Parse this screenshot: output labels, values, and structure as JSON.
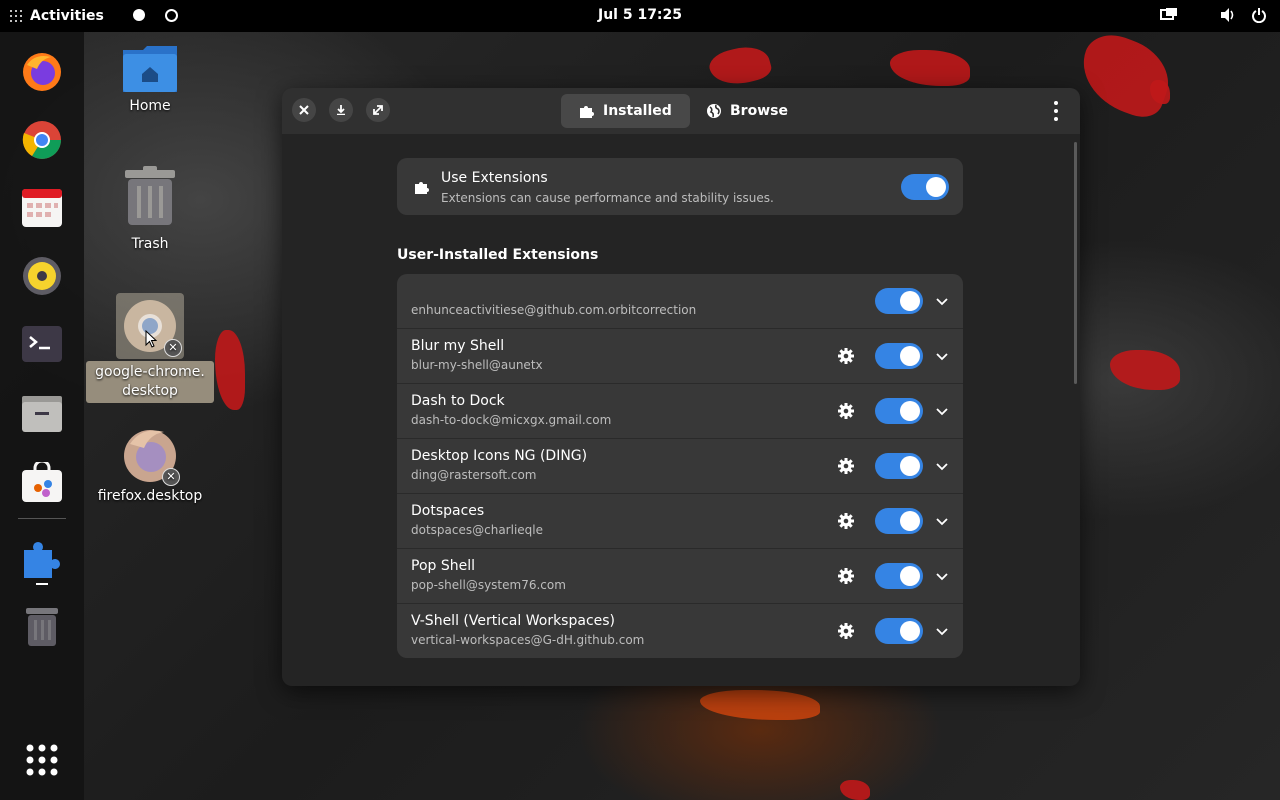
{
  "topbar": {
    "activities_label": "Activities",
    "clock": "Jul 5  17:25"
  },
  "desktop": {
    "icons": [
      {
        "label": "Home"
      },
      {
        "label": "Trash"
      },
      {
        "label": "google-chrome.\ndesktop"
      },
      {
        "label": "firefox.desktop"
      }
    ]
  },
  "dock": {
    "items": [
      "firefox-icon",
      "chrome-icon",
      "calendar-icon",
      "rhythmbox-icon",
      "terminal-icon",
      "files-icon",
      "software-icon",
      "extensions-icon",
      "trash-icon",
      "app-grid-icon"
    ]
  },
  "window": {
    "tabs": [
      {
        "label": "Installed",
        "active": true
      },
      {
        "label": "Browse",
        "active": false
      }
    ],
    "use_extensions": {
      "title": "Use Extensions",
      "subtitle": "Extensions can cause performance and stability issues.",
      "enabled": true
    },
    "section_title": "User-Installed Extensions",
    "extensions": [
      {
        "name": "",
        "id": "enhunceactivitiese@github.com.orbitcorrection",
        "has_settings": false,
        "enabled": true
      },
      {
        "name": "Blur my Shell",
        "id": "blur-my-shell@aunetx",
        "has_settings": true,
        "enabled": true
      },
      {
        "name": "Dash to Dock",
        "id": "dash-to-dock@micxgx.gmail.com",
        "has_settings": true,
        "enabled": true
      },
      {
        "name": "Desktop Icons NG (DING)",
        "id": "ding@rastersoft.com",
        "has_settings": true,
        "enabled": true
      },
      {
        "name": "Dotspaces",
        "id": "dotspaces@charlieqle",
        "has_settings": true,
        "enabled": true
      },
      {
        "name": "Pop Shell",
        "id": "pop-shell@system76.com",
        "has_settings": true,
        "enabled": true
      },
      {
        "name": "V-Shell (Vertical Workspaces)",
        "id": "vertical-workspaces@G-dH.github.com",
        "has_settings": true,
        "enabled": true
      }
    ]
  },
  "colors": {
    "accent": "#3584e4",
    "window_bg": "#242424",
    "card_bg": "#383838",
    "headerbar_bg": "#303030"
  }
}
